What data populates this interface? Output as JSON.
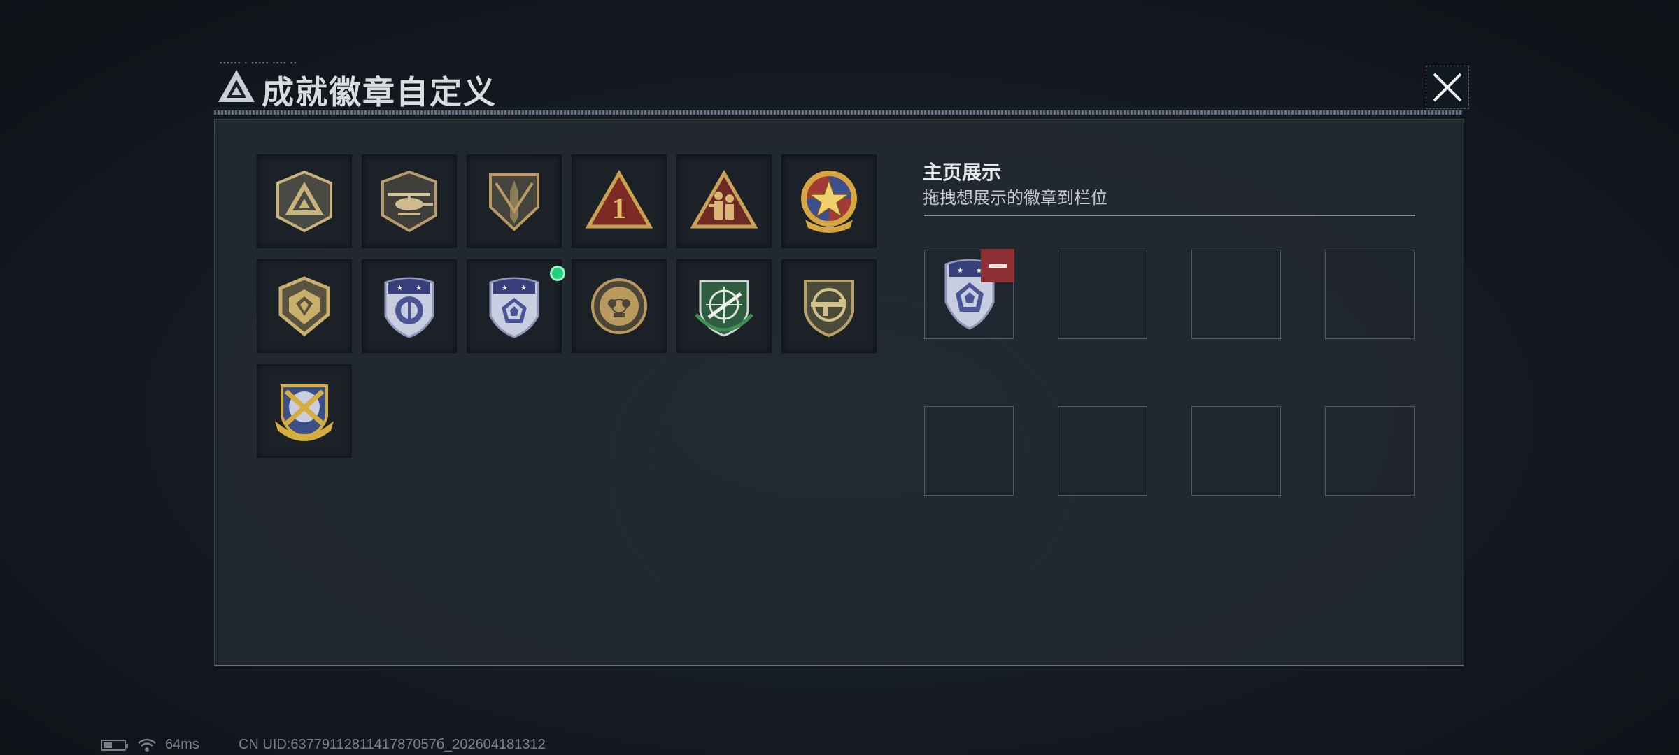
{
  "header": {
    "title": "成就徽章自定义",
    "close_icon": "close-icon"
  },
  "badges": [
    {
      "name": "triangle-shield-badge",
      "color": "#c9b37a"
    },
    {
      "name": "helicopter-badge",
      "color": "#b59c6c"
    },
    {
      "name": "dagger-shield-badge",
      "color": "#b89a63"
    },
    {
      "name": "number-one-triangle-badge",
      "color": "#c8a24e",
      "label": "1"
    },
    {
      "name": "soldiers-triangle-badge",
      "color": "#c9a257"
    },
    {
      "name": "star-medal-badge",
      "color": "#d8a640"
    },
    {
      "name": "gold-shield-badge",
      "color": "#c9b06a"
    },
    {
      "name": "blue-stars-emblem-badge",
      "color": "#5d66a8"
    },
    {
      "name": "blue-diamond-emblem-badge",
      "color": "#5d66a8",
      "new": true
    },
    {
      "name": "skull-crosshair-badge",
      "color": "#b99a5e"
    },
    {
      "name": "green-crosshair-rifle-badge",
      "color": "#3f7a55"
    },
    {
      "name": "rifle-crosshair-badge",
      "color": "#b8a06a"
    },
    {
      "name": "crossed-missiles-gold-badge",
      "color": "#d6ad3f"
    }
  ],
  "showcase": {
    "title": "主页展示",
    "subtitle": "拖拽想展示的徽章到栏位",
    "slots": [
      {
        "badge": "blue-diamond-emblem-badge"
      },
      {
        "badge": null
      },
      {
        "badge": null
      },
      {
        "badge": null
      },
      {
        "badge": null
      },
      {
        "badge": null
      },
      {
        "badge": null
      },
      {
        "badge": null
      }
    ]
  },
  "status_bar": {
    "ping": "64ms",
    "uid": "CN UID:6377911281141787057б_202604181312"
  }
}
